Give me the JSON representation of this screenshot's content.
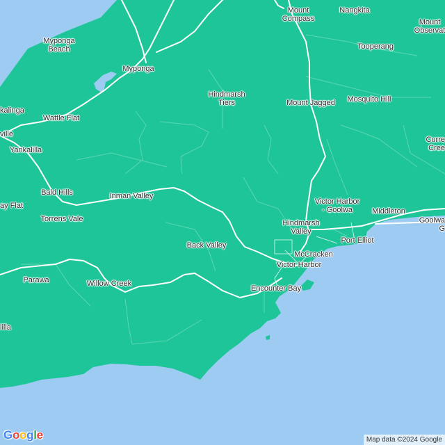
{
  "colors": {
    "water": "#9ecbf1",
    "land": "#1ec598",
    "road": "#ffffff",
    "minor_road": "#5bd7b4"
  },
  "places": [
    {
      "id": "mount-compass",
      "label": "Mount\nCompass"
    },
    {
      "id": "nangkita",
      "label": "Nangkita"
    },
    {
      "id": "mount-observation",
      "label": "Mount\nObservat"
    },
    {
      "id": "myponga-beach",
      "label": "Myponga\nBeach"
    },
    {
      "id": "tooperang",
      "label": "Tooperang"
    },
    {
      "id": "myponga",
      "label": "Myponga"
    },
    {
      "id": "hindmarsh-tiers",
      "label": "Hindmarsh\nTiers"
    },
    {
      "id": "mount-jagged",
      "label": "Mount Jagged"
    },
    {
      "id": "mosquito-hill",
      "label": "Mosquito Hill"
    },
    {
      "id": "yankalinga",
      "label": "kalinga"
    },
    {
      "id": "wattle-flat",
      "label": "Wattle Flat"
    },
    {
      "id": "normanville",
      "label": "ville"
    },
    {
      "id": "yankalilla",
      "label": "Yankalilla"
    },
    {
      "id": "currency-creek",
      "label": "Curre\nCree"
    },
    {
      "id": "bald-hills",
      "label": "Bald Hills"
    },
    {
      "id": "inman-valley",
      "label": "Inman Valley"
    },
    {
      "id": "victor-harbor-goolwa",
      "label": "Victor Harbor\n- Goolwa"
    },
    {
      "id": "middleton",
      "label": "Middleton"
    },
    {
      "id": "rapid-bay-flat",
      "label": "ay Flat"
    },
    {
      "id": "torrens-vale",
      "label": "Torrens Vale"
    },
    {
      "id": "goolwa-beach",
      "label": "Goolwa\nG"
    },
    {
      "id": "hindmarsh-valley",
      "label": "Hindmarsh\nValley"
    },
    {
      "id": "port-elliot",
      "label": "Port Elliot"
    },
    {
      "id": "back-valley",
      "label": "Back Valley"
    },
    {
      "id": "mccracken",
      "label": "McCracken"
    },
    {
      "id": "victor-harbor",
      "label": "Victor Harbor"
    },
    {
      "id": "parawa",
      "label": "Parawa"
    },
    {
      "id": "willow-creek",
      "label": "Willow Creek"
    },
    {
      "id": "encounter-bay",
      "label": "Encounter Bay"
    },
    {
      "id": "delamere",
      "label": "lilla"
    }
  ],
  "logo": {
    "letters": [
      "G",
      "o",
      "o",
      "g",
      "l",
      "e"
    ],
    "colors": [
      "#4285f4",
      "#ea4335",
      "#fbbc05",
      "#4285f4",
      "#34a853",
      "#ea4335"
    ]
  },
  "attribution": "Map data ©2024 Google"
}
